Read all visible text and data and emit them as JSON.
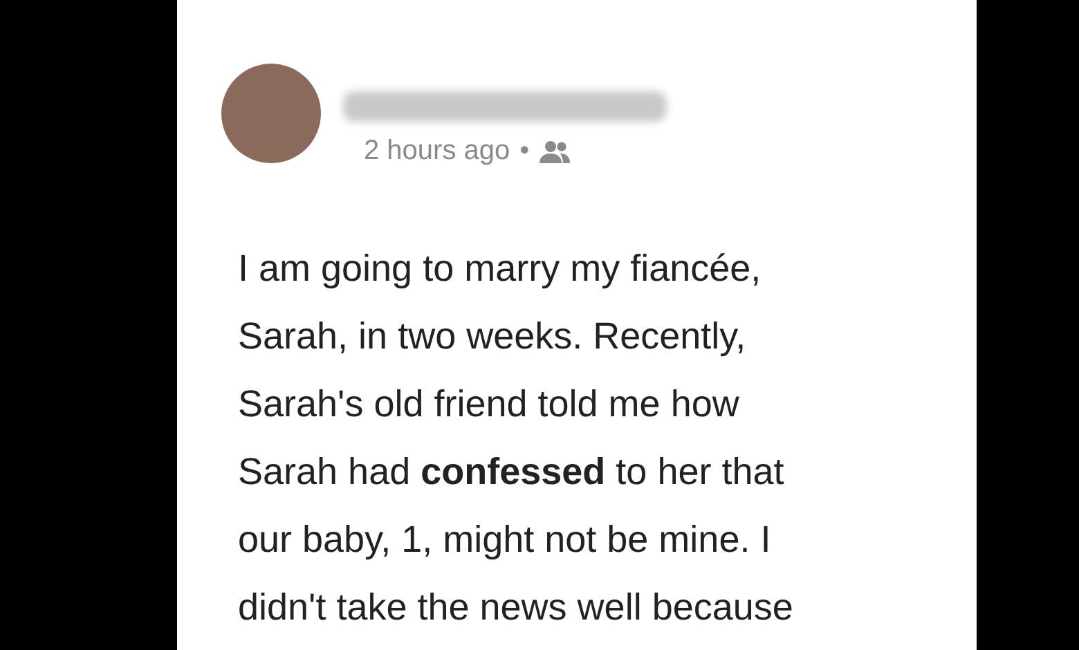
{
  "post": {
    "time": "2 hours ago",
    "separator": "•",
    "body": "I am going to marry my fiancée,\nSarah, in two weeks. Recently,\nSarah's old friend told me how\nSarah had **confessed** to her that\nour baby, 1, might not be mine. I\ndidn't take the news well because"
  }
}
